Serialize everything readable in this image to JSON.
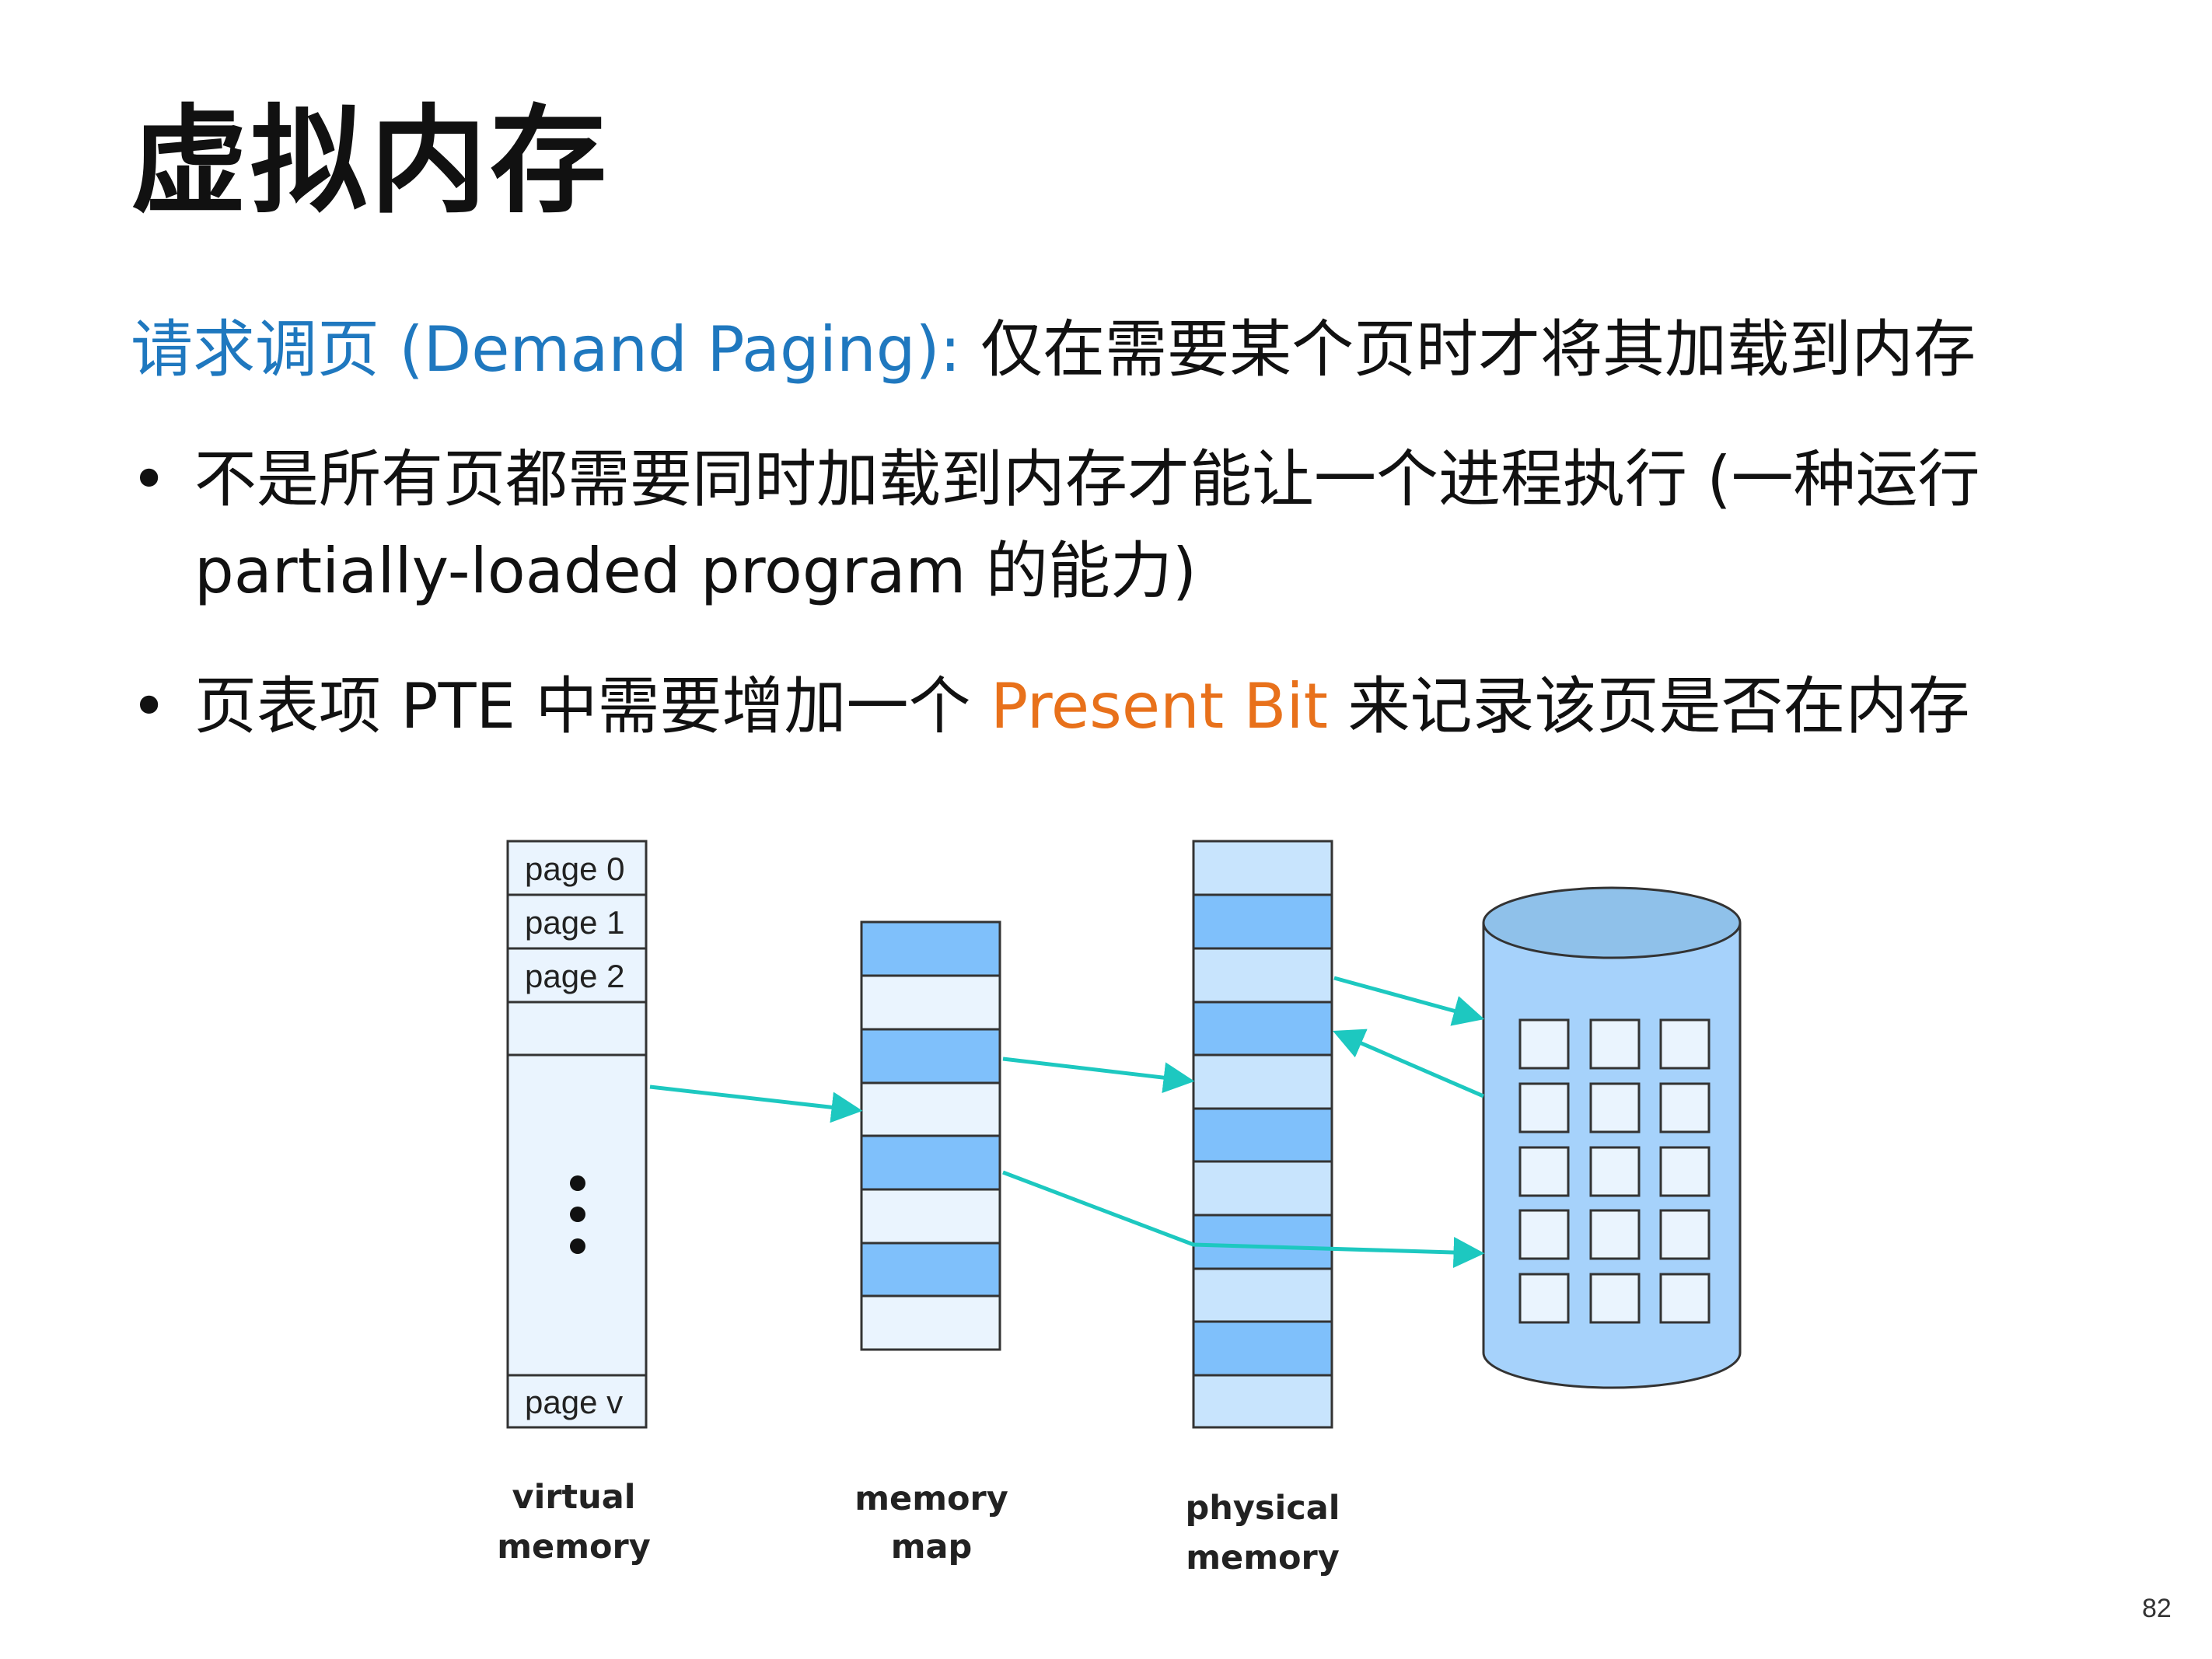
{
  "slide": {
    "title": "虚拟内存",
    "page_number": "82"
  },
  "intro": {
    "term": "请求调页 (Demand Paging):",
    "text": " 仅在需要某个页时才将其加载到内存"
  },
  "bullets": [
    {
      "line1": "不是所有页都需要同时加载到内存才能让一个进程执行 (一种运行",
      "line2": "partially-loaded program 的能力)"
    },
    {
      "before": "页表项 PTE 中需要增加一个 ",
      "highlight": "Present Bit",
      "after": " 来记录该页是否在内存"
    }
  ],
  "diagram": {
    "virtual_memory": {
      "pages": [
        "page 0",
        "page 1",
        "page 2",
        "",
        "page v"
      ],
      "ellipsis": "⋮",
      "caption_line1": "virtual",
      "caption_line2": "memory"
    },
    "memory_map": {
      "caption_line1": "memory",
      "caption_line2": "map"
    },
    "physical_memory": {
      "caption_line1": "physical",
      "caption_line2": "memory"
    },
    "colors": {
      "light_block": "#eaf4fe",
      "dark_block": "#7fc0fb",
      "pale_block": "#c8e4fd",
      "arrow": "#1dc8c0",
      "disk": "#a6d2fb",
      "disk_top": "#8fc1ea"
    }
  }
}
